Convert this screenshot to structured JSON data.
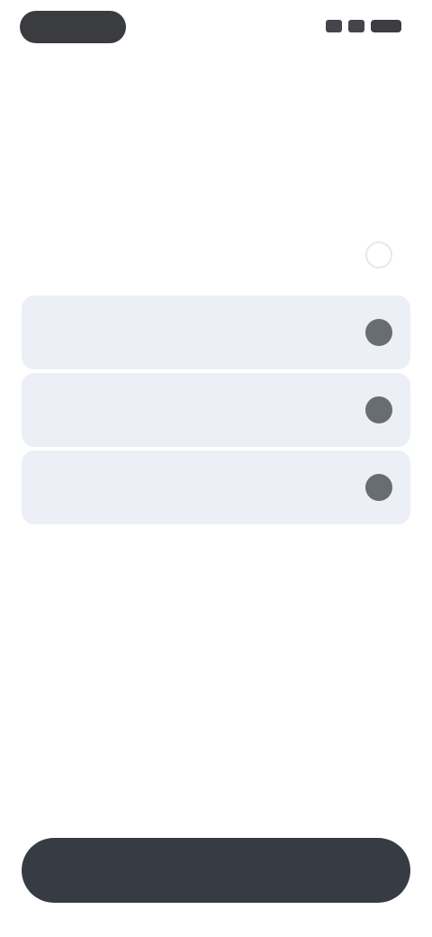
{
  "status_bar": {
    "icons": [
      "signal-icon",
      "wifi-icon",
      "battery-icon"
    ]
  },
  "header": {
    "link_label": ""
  },
  "question": {
    "text": ""
  },
  "options": [
    {
      "label": "",
      "selected": false
    },
    {
      "label": "",
      "selected": true
    },
    {
      "label": "",
      "selected": true
    },
    {
      "label": "",
      "selected": true
    }
  ],
  "footer": {
    "button_label": ""
  },
  "colors": {
    "accent": "#373b43",
    "selected_bg": "#eceff6",
    "radio_filled": "#686c73"
  }
}
